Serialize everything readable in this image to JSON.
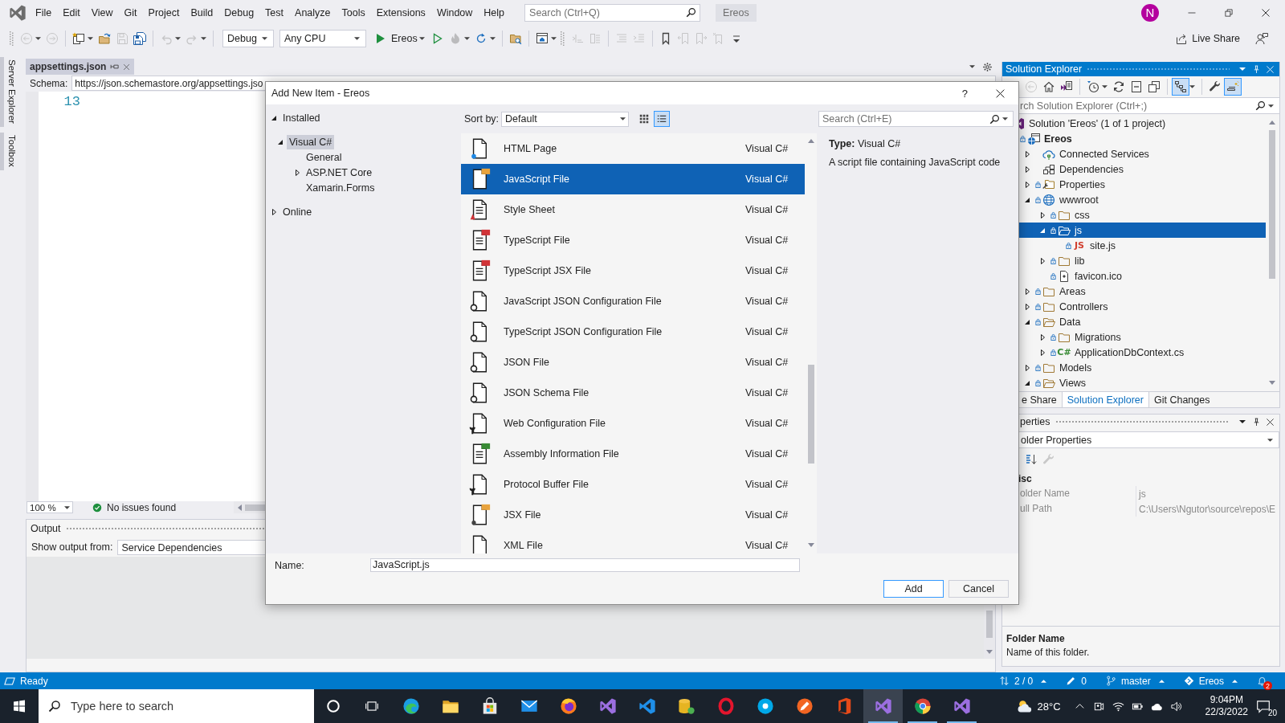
{
  "title_bar": {
    "menu": [
      "File",
      "Edit",
      "View",
      "Git",
      "Project",
      "Build",
      "Debug",
      "Test",
      "Analyze",
      "Tools",
      "Extensions",
      "Window",
      "Help"
    ],
    "search": {
      "placeholder": "Search (Ctrl+Q)"
    },
    "solution": "Ereos",
    "account": "N"
  },
  "toolbar": {
    "groups": [
      {
        "grip": true,
        "items": [
          {
            "kind": "back",
            "disabled": true,
            "dropdown": true
          },
          {
            "kind": "forward",
            "disabled": true,
            "dropdown": false
          }
        ]
      },
      {
        "grip": false,
        "items": [
          {
            "kind": "new",
            "disabled": false,
            "dropdown": true
          },
          {
            "kind": "open",
            "disabled": false,
            "dropdown": false
          },
          {
            "kind": "save",
            "disabled": true,
            "dropdown": false
          },
          {
            "kind": "save_all",
            "disabled": false,
            "dropdown": false
          }
        ]
      },
      {
        "grip": false,
        "items": [
          {
            "kind": "undo",
            "disabled": true,
            "dropdown": true
          },
          {
            "kind": "redo",
            "disabled": true,
            "dropdown": true
          }
        ]
      },
      {
        "grip": false,
        "items": [
          {
            "kind": "combo",
            "value": "Debug",
            "disabled": false,
            "dropdown": true
          },
          {
            "kind": "combo",
            "value": "Any CPU",
            "disabled": false,
            "dropdown": true
          },
          {
            "kind": "start",
            "label": "Ereos",
            "disabled": false,
            "dropdown": true
          },
          {
            "kind": "run",
            "disabled": false,
            "dropdown": false
          },
          {
            "kind": "reload",
            "disabled": true,
            "dropdown": true
          },
          {
            "kind": "restart",
            "disabled": false,
            "dropdown": true
          }
        ]
      },
      {
        "grip": false,
        "items": [
          {
            "kind": "find",
            "disabled": false,
            "dropdown": false
          }
        ]
      },
      {
        "grip": false,
        "items": [
          {
            "kind": "browser",
            "disabled": false,
            "dropdown": true
          }
        ]
      },
      {
        "grip": true,
        "items": [
          {
            "kind": "lines_arrow",
            "disabled": true,
            "dropdown": false
          },
          {
            "kind": "lines_stack",
            "disabled": true,
            "dropdown": false
          }
        ]
      },
      {
        "grip": false,
        "items": [
          {
            "kind": "list_lines",
            "disabled": true,
            "dropdown": false
          },
          {
            "kind": "list_arrow",
            "disabled": true,
            "dropdown": false
          }
        ]
      },
      {
        "grip": false,
        "items": [
          {
            "kind": "bookmark",
            "disabled": false,
            "dropdown": false
          },
          {
            "kind": "bookmark_prev",
            "disabled": true,
            "dropdown": false
          },
          {
            "kind": "bookmark_next",
            "disabled": true,
            "dropdown": false
          },
          {
            "kind": "bookmark_clear",
            "disabled": true,
            "dropdown": false
          },
          {
            "kind": "overflow",
            "disabled": false,
            "dropdown": false
          }
        ]
      }
    ],
    "live_share": "Live Share"
  },
  "side_tabs": [
    "Server Explorer",
    "Toolbox"
  ],
  "document": {
    "tabs": [
      {
        "title": "appsettings.json",
        "selected": true
      }
    ],
    "schema_label": "Schema:",
    "schema_value": "https://json.schemastore.org/appsettings.jso",
    "line_numbers": [
      "13"
    ],
    "zoom": "100 %",
    "issues": "No issues found"
  },
  "output": {
    "title": "Output",
    "source_label": "Show output from:",
    "source": "Service Dependencies"
  },
  "dialog": {
    "title": "Add New Item - Ereos",
    "help": "?",
    "tree": [
      {
        "label": "Installed",
        "expanded": true,
        "selected": false,
        "children": [
          {
            "label": "Visual C#",
            "expanded": true,
            "selected": true,
            "children": [
              {
                "label": "General",
                "selected": false
              },
              {
                "label": "ASP.NET Core",
                "expanded": false,
                "selected": false
              },
              {
                "label": "Xamarin.Forms",
                "selected": false
              }
            ]
          }
        ]
      },
      {
        "label": "Online",
        "expanded": false,
        "selected": false
      }
    ],
    "sort_label": "Sort by:",
    "sort_value": "Default",
    "view_modes": [
      {
        "kind": "grid",
        "selected": false
      },
      {
        "kind": "list",
        "selected": true
      }
    ],
    "templates": [
      {
        "name": "HTML Page",
        "category": "Visual C#",
        "kind": "html",
        "selected": false
      },
      {
        "name": "JavaScript File",
        "category": "Visual C#",
        "kind": "script",
        "selected": true
      },
      {
        "name": "Style Sheet",
        "category": "Visual C#",
        "kind": "style",
        "selected": false
      },
      {
        "name": "TypeScript File",
        "category": "Visual C#",
        "kind": "typescript",
        "selected": false
      },
      {
        "name": "TypeScript JSX File",
        "category": "Visual C#",
        "kind": "typescript",
        "selected": false
      },
      {
        "name": "JavaScript JSON Configuration File",
        "category": "Visual C#",
        "kind": "json",
        "selected": false
      },
      {
        "name": "TypeScript JSON Configuration File",
        "category": "Visual C#",
        "kind": "json",
        "selected": false
      },
      {
        "name": "JSON File",
        "category": "Visual C#",
        "kind": "json",
        "selected": false
      },
      {
        "name": "JSON Schema File",
        "category": "Visual C#",
        "kind": "json",
        "selected": false
      },
      {
        "name": "Web Configuration File",
        "category": "Visual C#",
        "kind": "config",
        "selected": false
      },
      {
        "name": "Assembly Information File",
        "category": "Visual C#",
        "kind": "csharp",
        "selected": false
      },
      {
        "name": "Protocol Buffer File",
        "category": "Visual C#",
        "kind": "config",
        "selected": false
      },
      {
        "name": "JSX File",
        "category": "Visual C#",
        "kind": "jsx",
        "selected": false
      },
      {
        "name": "XML File",
        "category": "Visual C#",
        "kind": "xml",
        "selected": false
      }
    ],
    "search": {
      "placeholder": "Search (Ctrl+E)"
    },
    "details": {
      "type": "**Type:**  Visual C#",
      "description": "A script file containing JavaScript code"
    },
    "name_label": "Name:",
    "name_value": "JavaScript.js",
    "buttons": [
      {
        "label": "Add",
        "kind": "default"
      },
      {
        "label": "Cancel",
        "kind": "normal"
      }
    ]
  },
  "solution_explorer": {
    "title": "Solution Explorer",
    "focused": true,
    "toolbar": {
      "groups": [
        [
          {
            "kind": "back",
            "disabled": true,
            "dropdown": false,
            "on": false
          },
          {
            "kind": "home",
            "disabled": false,
            "dropdown": false,
            "on": false
          },
          {
            "kind": "switch",
            "disabled": false,
            "dropdown": false,
            "on": false
          }
        ],
        [
          {
            "kind": "history",
            "disabled": false,
            "dropdown": true,
            "on": false
          },
          {
            "kind": "sync",
            "disabled": false,
            "dropdown": false,
            "on": false
          },
          {
            "kind": "collapse",
            "disabled": false,
            "dropdown": false,
            "on": false
          },
          {
            "kind": "copies",
            "disabled": false,
            "dropdown": false,
            "on": false
          }
        ],
        [
          {
            "kind": "tree",
            "disabled": false,
            "dropdown": true,
            "on": true
          }
        ],
        [
          {
            "kind": "wrench",
            "disabled": false,
            "dropdown": false,
            "on": false
          },
          {
            "kind": "preview",
            "disabled": false,
            "dropdown": false,
            "on": true
          }
        ]
      ]
    },
    "search": {
      "placeholder": "rch Solution Explorer (Ctrl+;)"
    },
    "tree": [
      {
        "label": "Solution 'Ereos' (1 of 1 project)",
        "kind": "solution",
        "selected": false,
        "children": [
          {
            "label": "Ereos",
            "kind": "project",
            "locked": true,
            "selected": false,
            "children": [
              {
                "label": "Connected Services",
                "kind": "service",
                "expanded": false,
                "locked": false,
                "selected": false
              },
              {
                "label": "Dependencies",
                "kind": "dependencies",
                "expanded": false,
                "locked": false,
                "selected": false
              },
              {
                "label": "Properties",
                "kind": "properties",
                "expanded": false,
                "locked": true,
                "selected": false
              },
              {
                "label": "wwwroot",
                "kind": "web",
                "expanded": true,
                "locked": true,
                "selected": false,
                "children": [
                  {
                    "label": "css",
                    "kind": "folder",
                    "expanded": false,
                    "locked": true,
                    "selected": false
                  },
                  {
                    "label": "js",
                    "kind": "folder",
                    "expanded": true,
                    "locked": true,
                    "selected": true,
                    "children": [
                      {
                        "label": "site.js",
                        "kind": "script",
                        "badge": "JS",
                        "locked": true,
                        "selected": false
                      }
                    ]
                  },
                  {
                    "label": "lib",
                    "kind": "folder",
                    "expanded": false,
                    "locked": true,
                    "selected": false
                  },
                  {
                    "label": "favicon.ico",
                    "kind": "image",
                    "locked": true,
                    "selected": false
                  }
                ]
              },
              {
                "label": "Areas",
                "kind": "folder",
                "expanded": false,
                "locked": true,
                "selected": false
              },
              {
                "label": "Controllers",
                "kind": "folder",
                "expanded": false,
                "locked": true,
                "selected": false
              },
              {
                "label": "Data",
                "kind": "folder",
                "expanded": true,
                "locked": true,
                "selected": false,
                "children": [
                  {
                    "label": "Migrations",
                    "kind": "folder",
                    "expanded": false,
                    "locked": true,
                    "selected": false
                  },
                  {
                    "label": "ApplicationDbContext.cs",
                    "kind": "code",
                    "badge": "C#",
                    "expanded": false,
                    "locked": true,
                    "selected": false
                  }
                ]
              },
              {
                "label": "Models",
                "kind": "folder",
                "expanded": false,
                "locked": true,
                "selected": false
              },
              {
                "label": "Views",
                "kind": "folder",
                "expanded": true,
                "locked": true,
                "selected": false
              }
            ]
          }
        ]
      }
    ],
    "tabs": [
      {
        "label": "e Share",
        "selected": false
      },
      {
        "label": "Solution Explorer",
        "selected": true
      },
      {
        "label": "Git Changes",
        "selected": false
      }
    ]
  },
  "properties": {
    "title": "perties",
    "focused": false,
    "object": "older Properties",
    "toolbar": [
      {
        "kind": "sort",
        "disabled": false,
        "dropdown": false,
        "on": false
      },
      {
        "kind": "wrench",
        "disabled": true,
        "dropdown": false,
        "on": false
      }
    ],
    "categories": [
      {
        "name": "isc",
        "rows": [
          {
            "name": "older Name",
            "value": "js",
            "read_only": true
          },
          {
            "name": "ull Path",
            "value": "C:\\Users\\Ngutor\\source\\repos\\E",
            "read_only": true
          }
        ]
      }
    ],
    "description": {
      "title": "Folder Name",
      "text": "Name of this folder."
    }
  },
  "status_bar": {
    "message": "Ready",
    "items": [
      {
        "kind": "sync",
        "text": "2 / 0",
        "dropdown": true
      },
      {
        "kind": "edits",
        "text": "0",
        "dropdown": false
      },
      {
        "kind": "branch",
        "text": "master",
        "dropdown": true
      },
      {
        "kind": "repo",
        "text": "Ereos",
        "dropdown": true
      }
    ],
    "notifications": "2"
  },
  "taskbar": {
    "search": {
      "placeholder": "Type here to search"
    },
    "apps": [
      {
        "kind": "swirl",
        "open": false,
        "selected": false
      },
      {
        "kind": "folder",
        "open": false,
        "selected": false
      },
      {
        "kind": "bag",
        "open": false,
        "selected": false
      },
      {
        "kind": "envelope",
        "open": false,
        "selected": false
      },
      {
        "kind": "globe",
        "open": false,
        "selected": false
      },
      {
        "kind": "ribbon",
        "open": false,
        "selected": false
      },
      {
        "kind": "fold",
        "open": false,
        "selected": false
      },
      {
        "kind": "cylinder",
        "open": false,
        "selected": false
      },
      {
        "kind": "ring",
        "open": false,
        "selected": false
      },
      {
        "kind": "bubble",
        "open": false,
        "selected": false
      },
      {
        "kind": "pen",
        "open": false,
        "selected": false
      },
      {
        "kind": "door",
        "open": false,
        "selected": false
      },
      {
        "kind": "ribbon",
        "open": true,
        "selected": true
      },
      {
        "kind": "wheel",
        "open": true,
        "selected": false
      },
      {
        "kind": "ribbon",
        "open": true,
        "selected": false
      }
    ],
    "weather": "28°C",
    "time": "9:04PM",
    "date": "22/3/2022",
    "notifications": "20"
  }
}
